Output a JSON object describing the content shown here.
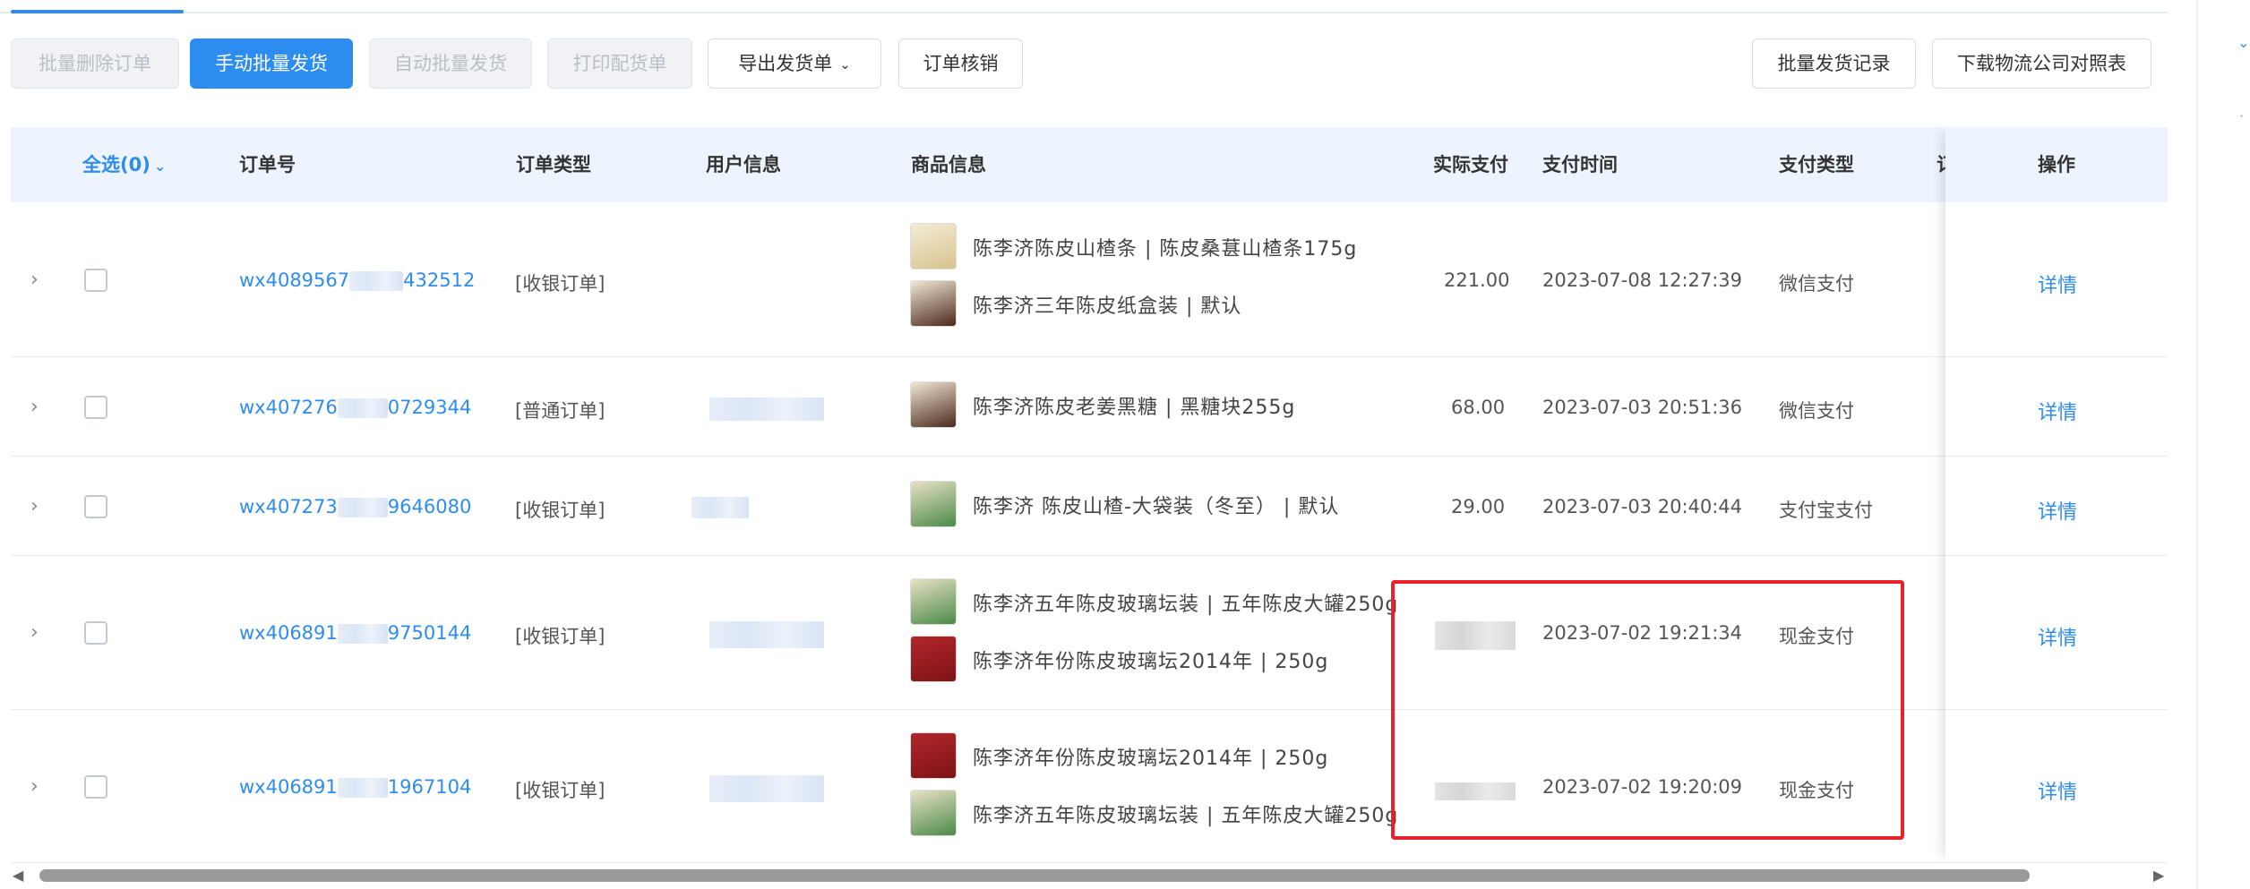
{
  "toolbar": {
    "batch_delete": "批量删除订单",
    "manual_batch_ship": "手动批量发货",
    "auto_batch_ship": "自动批量发货",
    "print_pick": "打印配货单",
    "export_ship": "导出发货单",
    "order_verify": "订单核销",
    "batch_ship_record": "批量发货记录",
    "download_logistics": "下载物流公司对照表"
  },
  "table": {
    "headers": {
      "select_all": "全选(0)",
      "order_no": "订单号",
      "order_type": "订单类型",
      "user_info": "用户信息",
      "product_info": "商品信息",
      "actual_pay": "实际支付",
      "pay_time": "支付时间",
      "pay_type": "支付类型",
      "hidden_col": "订",
      "action": "操作"
    },
    "rows": [
      {
        "order_no_prefix": "wx4089567",
        "order_no_suffix": "432512",
        "order_type": "[收银订单]",
        "products": [
          "陈李济陈皮山楂条 | 陈皮桑葚山楂条175g",
          "陈李济三年陈皮纸盒装 | 默认"
        ],
        "actual_pay": "221.00",
        "pay_time": "2023-07-08 12:27:39",
        "pay_type": "微信支付",
        "action": "详情"
      },
      {
        "order_no_prefix": "wx407276",
        "order_no_suffix": "0729344",
        "order_type": "[普通订单]",
        "products": [
          "陈李济陈皮老姜黑糖 | 黑糖块255g"
        ],
        "actual_pay": "68.00",
        "pay_time": "2023-07-03 20:51:36",
        "pay_type": "微信支付",
        "action": "详情"
      },
      {
        "order_no_prefix": "wx407273",
        "order_no_suffix": "9646080",
        "order_type": "[收银订单]",
        "products": [
          "陈李济 陈皮山楂-大袋装（冬至） | 默认"
        ],
        "actual_pay": "29.00",
        "pay_time": "2023-07-03 20:40:44",
        "pay_type": "支付宝支付",
        "action": "详情"
      },
      {
        "order_no_prefix": "wx406891",
        "order_no_suffix": "9750144",
        "order_type": "[收银订单]",
        "products": [
          "陈李济五年陈皮玻璃坛装 | 五年陈皮大罐250g",
          "陈李济年份陈皮玻璃坛2014年 | 250g"
        ],
        "actual_pay": "",
        "pay_time": "2023-07-02 19:21:34",
        "pay_type": "现金支付",
        "action": "详情"
      },
      {
        "order_no_prefix": "wx406891",
        "order_no_suffix": "1967104",
        "order_type": "[收银订单]",
        "products": [
          "陈李济年份陈皮玻璃坛2014年 | 250g",
          "陈李济五年陈皮玻璃坛装 | 五年陈皮大罐250g"
        ],
        "actual_pay": "",
        "pay_time": "2023-07-02 19:20:09",
        "pay_type": "现金支付",
        "action": "详情"
      }
    ]
  },
  "icons": {
    "expand": "chevron-right-icon",
    "dropdown": "chevron-down-icon",
    "scroll_left": "arrow-left-icon",
    "scroll_right": "arrow-right-icon"
  },
  "colors": {
    "accent": "#2d8cf0",
    "highlight": "#e8222a",
    "header_bg": "#edf4fd"
  }
}
